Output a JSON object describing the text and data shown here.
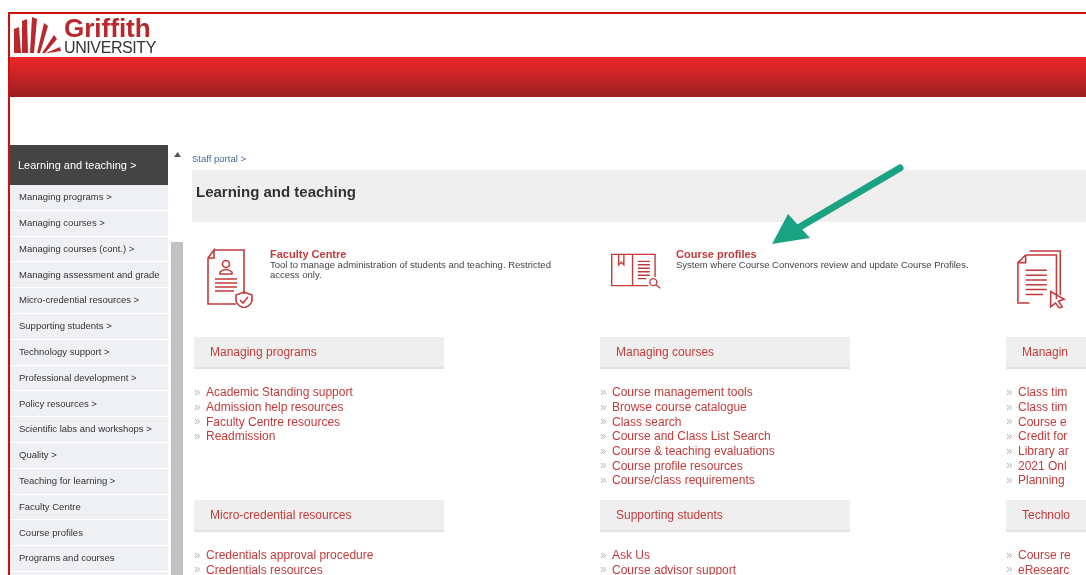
{
  "logo": {
    "name": "Griffith",
    "subtitle": "UNIVERSITY"
  },
  "sidebar": {
    "heading": "Learning and teaching >",
    "items": [
      {
        "label": "Managing programs >"
      },
      {
        "label": "Managing courses >"
      },
      {
        "label": "Managing courses (cont.) >"
      },
      {
        "label": "Managing assessment and grade"
      },
      {
        "label": "Micro-credential resources >"
      },
      {
        "label": "Supporting students >"
      },
      {
        "label": "Technology support >"
      },
      {
        "label": "Professional development >"
      },
      {
        "label": "Policy resources >"
      },
      {
        "label": "Scientific labs and workshops >"
      },
      {
        "label": "Quality >"
      },
      {
        "label": "Teaching for learning >"
      },
      {
        "label": "Faculty Centre"
      },
      {
        "label": "Course profiles"
      },
      {
        "label": "Programs and courses"
      }
    ]
  },
  "breadcrumb": "Staff portal >",
  "page_title": "Learning and teaching",
  "tools": [
    {
      "kind": "certificate",
      "title": "Faculty Centre",
      "description": "Tool to manage administration of students and teaching. Restricted access only."
    },
    {
      "kind": "book",
      "title": "Course profiles",
      "description": "System where Course Convenors review and update Course Profiles."
    },
    {
      "kind": "documents"
    }
  ],
  "sections": [
    {
      "title": "Managing programs",
      "links": [
        "Academic Standing support",
        "Admission help resources",
        "Faculty Centre resources",
        "Readmission"
      ]
    },
    {
      "title": "Managing courses",
      "links": [
        "Course management tools",
        "Browse course catalogue",
        "Class search",
        "Course and Class List Search",
        "Course & teaching evaluations",
        "Course profile resources",
        "Course/class requirements"
      ]
    },
    {
      "title": "Managin",
      "links": [
        "Class tim",
        "Class tim",
        "Course e",
        "Credit for",
        "Library ar",
        "2021 Onl",
        "Planning"
      ]
    },
    {
      "title": "Micro-credential resources",
      "links": [
        "Credentials approval procedure",
        "Credentials resources"
      ]
    },
    {
      "title": "Supporting students",
      "links": [
        "Ask Us",
        "Course advisor support"
      ]
    },
    {
      "title": "Technolo",
      "links": [
        "Course re",
        "eResearc"
      ]
    }
  ]
}
